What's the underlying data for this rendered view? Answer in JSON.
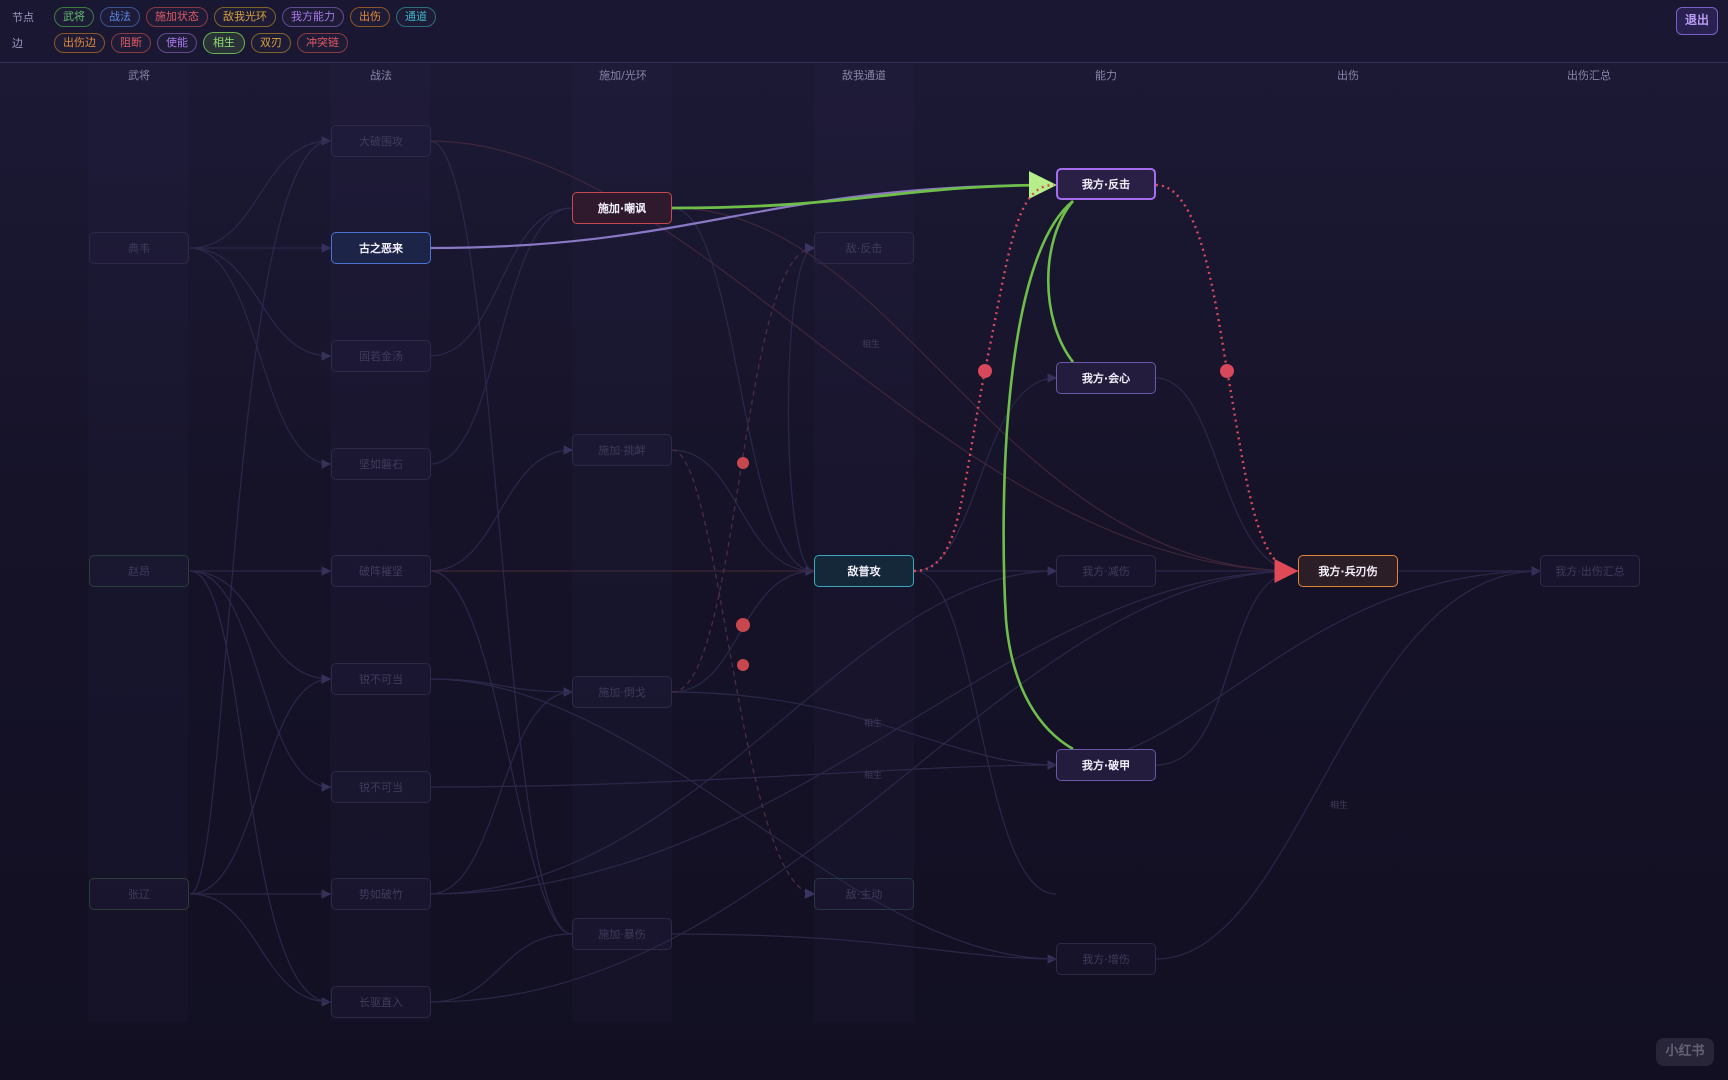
{
  "filter_bar": {
    "node_row": {
      "label": "节点",
      "chips": [
        {
          "label": "武将",
          "color": "#5fbf6a"
        },
        {
          "label": "战法",
          "color": "#5b8be8"
        },
        {
          "label": "施加状态",
          "color": "#e05a62"
        },
        {
          "label": "敌我光环",
          "color": "#d4a13c"
        },
        {
          "label": "我方能力",
          "color": "#a87ae8"
        },
        {
          "label": "出伤",
          "color": "#e08a3c"
        },
        {
          "label": "通道",
          "color": "#3cb6c8"
        }
      ]
    },
    "edge_row": {
      "label": "边",
      "chips": [
        {
          "label": "出伤边",
          "color": "#e08a3c"
        },
        {
          "label": "阻断",
          "color": "#e05a62"
        },
        {
          "label": "使能",
          "color": "#a87ae8"
        },
        {
          "label": "相生",
          "color": "#7ccc5c",
          "active": true
        },
        {
          "label": "双刃",
          "color": "#d4a13c"
        },
        {
          "label": "冲突链",
          "color": "#e05a62"
        }
      ]
    },
    "exit_label": "退出"
  },
  "columns": [
    "武将",
    "战法",
    "施加/光环",
    "敌我通道",
    "能力",
    "出伤",
    "出伤汇总"
  ],
  "nodes": {
    "dianwei": "典韦",
    "zhaoyun": "赵昂",
    "zhangliao": "张辽",
    "dayi": "大破围攻",
    "guzhi": "古之恶来",
    "guruo": "固若金汤",
    "jianru": "坚如磐石",
    "pozhen": "破阵摧坚",
    "shi1": "锐不可当",
    "shi2": "锐不可当",
    "shipo": "势如破竹",
    "changqu": "长驱直入",
    "shijia_chaofeng": "施加·嘲讽",
    "shijia_haozhao": "施加·挑衅",
    "shijia_jiechi": "施加·倒戈",
    "shijia_baoji": "施加·暴伤",
    "di_fanji": "敌·反击",
    "di_pugong": "敌普攻",
    "di_zhudong": "敌·主动",
    "fanji": "我方·反击",
    "huixin": "我方·会心",
    "jianshang": "我方·减伤",
    "pojia": "我方·破甲",
    "zengshang": "我方·增伤",
    "bingren": "我方·兵刃伤",
    "huizong": "我方·出伤汇总"
  },
  "edge_labels": [
    "相生",
    "相生",
    "相生",
    "相生"
  ],
  "watermark": "小红书"
}
